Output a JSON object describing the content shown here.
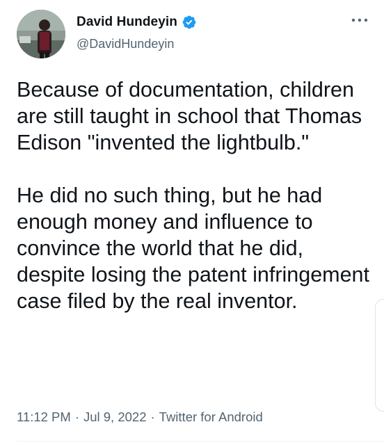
{
  "author": {
    "display_name": "David Hundeyin",
    "handle": "@DavidHundeyin",
    "verified": true,
    "avatar_icon": "profile-photo"
  },
  "tweet": {
    "paragraphs": [
      "Because of documentation, children are still taught in school that Thomas Edison \"invented the lightbulb.\"",
      "He did no such thing, but he had enough money and influence to convince the world that he did, despite losing the patent infringement case filed by the real inventor."
    ]
  },
  "meta": {
    "time": "11:12 PM",
    "date": "Jul 9, 2022",
    "source": "Twitter for Android",
    "separator": "·"
  },
  "icons": {
    "more": "more-dots-icon",
    "verified": "verified-badge-icon"
  },
  "colors": {
    "verified_blue": "#1d9bf0",
    "secondary_text": "#536471",
    "primary_text": "#0f1419"
  }
}
